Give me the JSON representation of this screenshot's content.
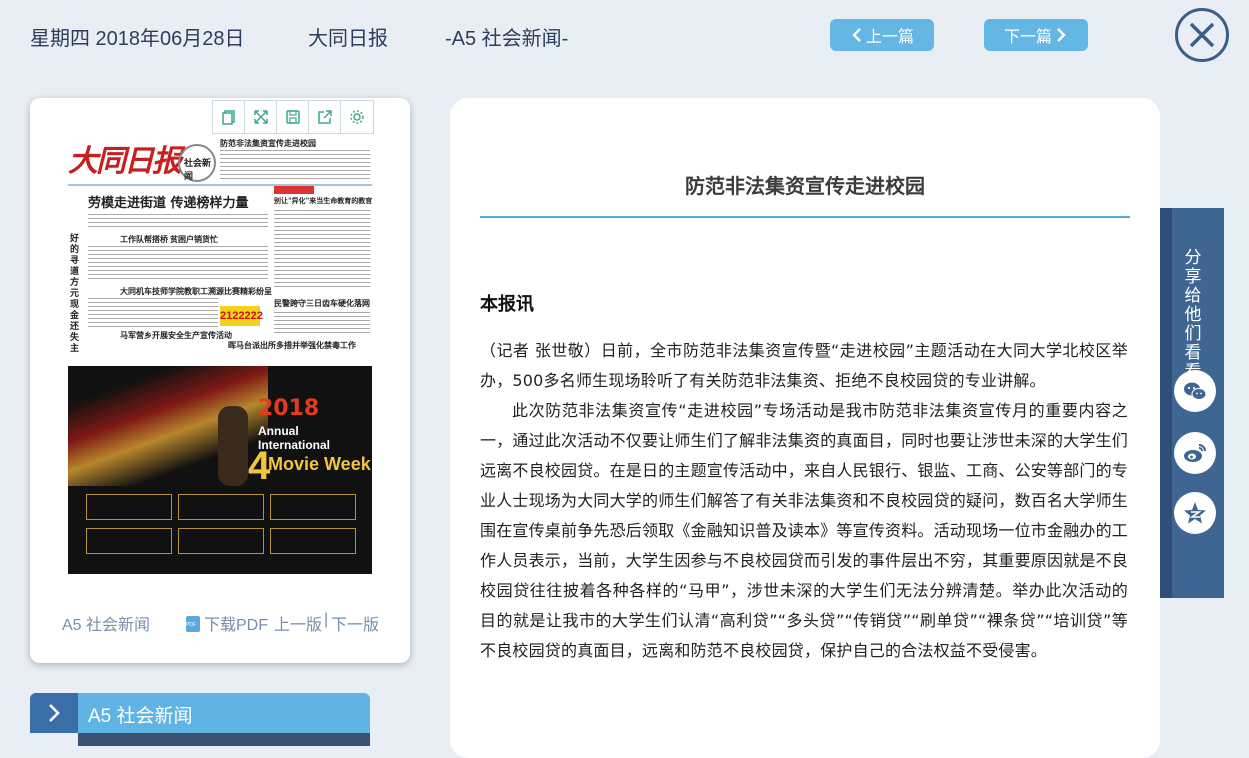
{
  "header": {
    "date": "星期四 2018年06月28日",
    "paper_name": "大同日报",
    "section": "-A5 社会新闻-",
    "prev_label": "上一篇",
    "next_label": "下一篇"
  },
  "thumbnail": {
    "masthead": "大同日报",
    "section_logo": "社会新闻",
    "headlines": [
      "防范非法集资宣传走进校园",
      "劳模走进街道  传递榜样力量",
      "别让\"异化\"来当生命教育的教官",
      "工作队帮搭桥",
      "贫困户销货忙",
      "大同机车技师学院教职工溯源比赛精彩纷呈",
      "民警跨守三日",
      "齿车硬化落网",
      "马军营乡开展安全生产宣传活动",
      "晖马台派出所多措并举强化禁毒工作",
      "好的寻道方元现金还失主"
    ],
    "lottery_number": "2122222",
    "poster": {
      "year": "2018",
      "event_line1": "Annual International",
      "event_number": "4",
      "event_line2": "Movie Week"
    }
  },
  "thumb_footer": {
    "section": "A5 社会新闻",
    "download": "下载PDF",
    "prev_page": "上一版",
    "separator": "|",
    "next_page": "下一版"
  },
  "section_nav": {
    "label": "A5  社会新闻"
  },
  "article": {
    "title": "防范非法集资宣传走进校园",
    "subtitle": "本报讯",
    "paragraphs": [
      "（记者 张世敬）日前，全市防范非法集资宣传暨“走进校园”主题活动在大同大学北校区举办，500多名师生现场聆听了有关防范非法集资、拒绝不良校园贷的专业讲解。",
      "此次防范非法集资宣传“走进校园”专场活动是我市防范非法集资宣传月的重要内容之一，通过此次活动不仅要让师生们了解非法集资的真面目，同时也要让涉世未深的大学生们远离不良校园贷。在是日的主题宣传活动中，来自人民银行、银监、工商、公安等部门的专业人士现场为大同大学的师生们解答了有关非法集资和不良校园贷的疑问，数百名大学师生围在宣传桌前争先恐后领取《金融知识普及读本》等宣传资料。活动现场一位市金融办的工作人员表示，当前，大学生因参与不良校园贷而引发的事件层出不穷，其重要原因就是不良校园贷往往披着各种各样的“马甲”，涉世未深的大学生们无法分辨清楚。举办此次活动的目的就是让我市的大学生们认清“高利贷”“多头贷”“传销贷”“刷单贷”“裸条贷”“培训贷”等不良校园贷的真面目，远离和防范不良校园贷，保护自己的合法权益不受侵害。"
    ]
  },
  "share": {
    "label": "分享给他们看看",
    "icons": [
      "wechat-icon",
      "weibo-icon",
      "qzone-icon"
    ]
  },
  "colors": {
    "background": "#e8eef4",
    "button": "#64b6e4",
    "accent_dark": "#3f6593",
    "rule": "#5aa9d8"
  }
}
